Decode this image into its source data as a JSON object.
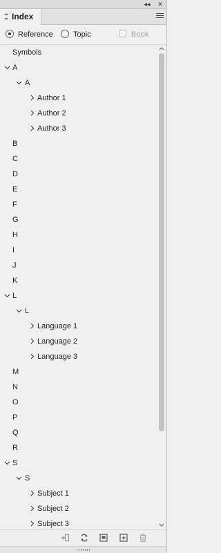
{
  "panel": {
    "tab_title": "Index",
    "collapse_glyph": "◂◂",
    "close_glyph": "✕"
  },
  "options": {
    "reference_label": "Reference",
    "topic_label": "Topic",
    "book_label": "Book",
    "selected": "Reference",
    "book_checked": false
  },
  "tree": [
    {
      "label": "Symbols",
      "level": 0,
      "toggle": "none"
    },
    {
      "label": "A",
      "level": 0,
      "toggle": "open"
    },
    {
      "label": "A",
      "level": 1,
      "toggle": "open"
    },
    {
      "label": "Author 1",
      "level": 2,
      "toggle": "closed"
    },
    {
      "label": "Author 2",
      "level": 2,
      "toggle": "closed"
    },
    {
      "label": "Author 3",
      "level": 2,
      "toggle": "closed"
    },
    {
      "label": "B",
      "level": 0,
      "toggle": "none"
    },
    {
      "label": "C",
      "level": 0,
      "toggle": "none"
    },
    {
      "label": "D",
      "level": 0,
      "toggle": "none"
    },
    {
      "label": "E",
      "level": 0,
      "toggle": "none"
    },
    {
      "label": "F",
      "level": 0,
      "toggle": "none"
    },
    {
      "label": "G",
      "level": 0,
      "toggle": "none"
    },
    {
      "label": "H",
      "level": 0,
      "toggle": "none"
    },
    {
      "label": "I",
      "level": 0,
      "toggle": "none"
    },
    {
      "label": "J",
      "level": 0,
      "toggle": "none"
    },
    {
      "label": "K",
      "level": 0,
      "toggle": "none"
    },
    {
      "label": "L",
      "level": 0,
      "toggle": "open"
    },
    {
      "label": "L",
      "level": 1,
      "toggle": "open"
    },
    {
      "label": "Language 1",
      "level": 2,
      "toggle": "closed"
    },
    {
      "label": "Language 2",
      "level": 2,
      "toggle": "closed"
    },
    {
      "label": "Language 3",
      "level": 2,
      "toggle": "closed"
    },
    {
      "label": "M",
      "level": 0,
      "toggle": "none"
    },
    {
      "label": "N",
      "level": 0,
      "toggle": "none"
    },
    {
      "label": "O",
      "level": 0,
      "toggle": "none"
    },
    {
      "label": "P",
      "level": 0,
      "toggle": "none"
    },
    {
      "label": "Q",
      "level": 0,
      "toggle": "none"
    },
    {
      "label": "R",
      "level": 0,
      "toggle": "none"
    },
    {
      "label": "S",
      "level": 0,
      "toggle": "open"
    },
    {
      "label": "S",
      "level": 1,
      "toggle": "open"
    },
    {
      "label": "Subject 1",
      "level": 2,
      "toggle": "closed"
    },
    {
      "label": "Subject 2",
      "level": 2,
      "toggle": "closed"
    },
    {
      "label": "Subject 3",
      "level": 2,
      "toggle": "closed"
    }
  ],
  "toolbar_icons": [
    "go-to-selected-marker-icon",
    "update-preview-icon",
    "generate-index-icon",
    "create-new-entry-icon",
    "delete-entry-icon"
  ],
  "colors": {
    "panel_bg": "#f0f0f0",
    "scrollbar_thumb": "#c2c2c2",
    "disabled_text": "#a8a8a8"
  }
}
